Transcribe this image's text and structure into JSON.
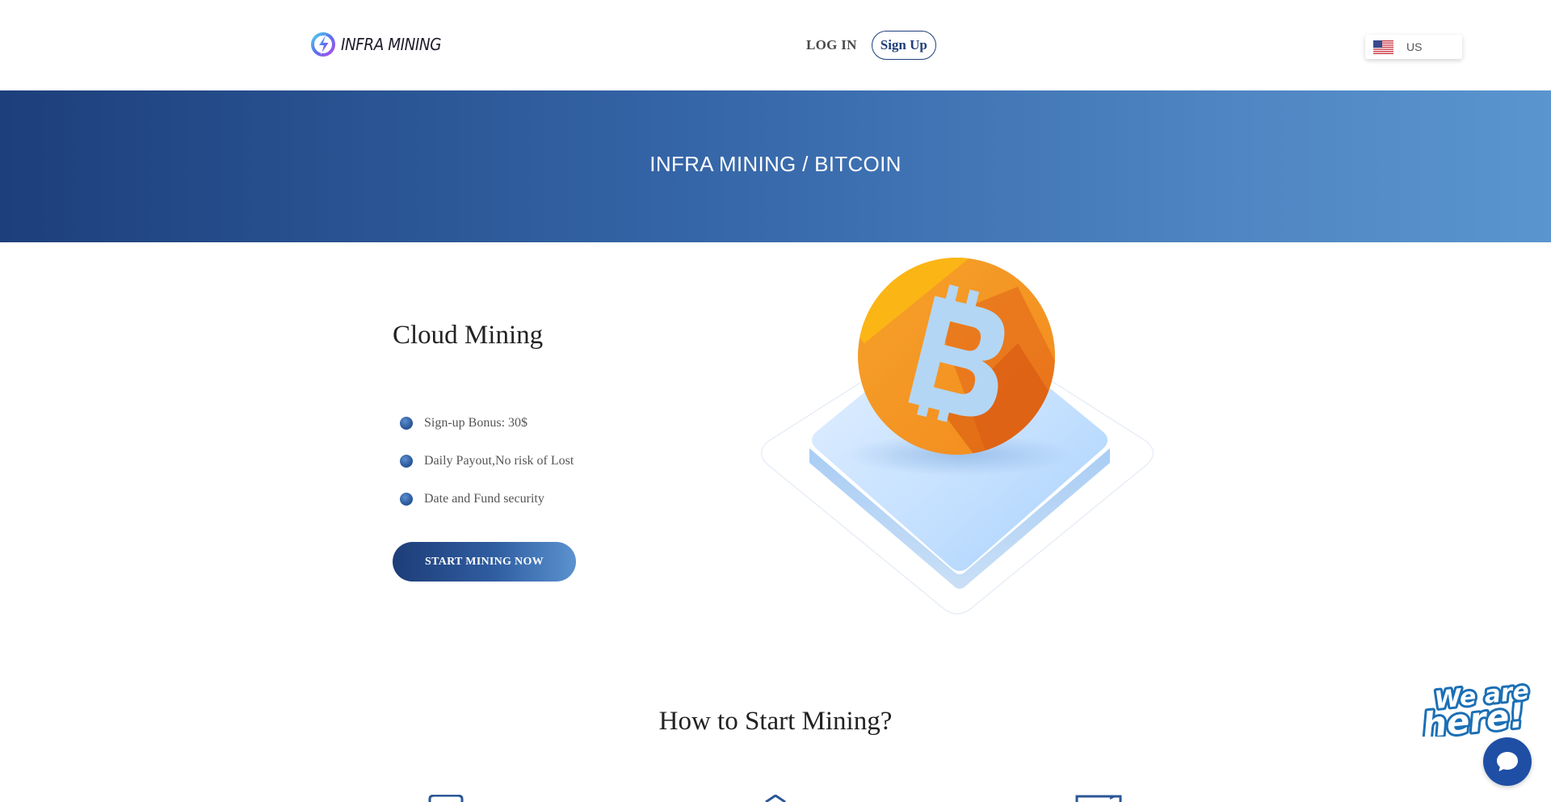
{
  "header": {
    "logo_text": "INFRA  MINING",
    "login_label": "LOG IN",
    "signup_label": "Sign Up",
    "language": {
      "selected": "US",
      "flag_icon": "us-flag-icon"
    }
  },
  "banner": {
    "title": "INFRA MINING / BITCOIN"
  },
  "hero": {
    "heading": "Cloud Mining",
    "features": [
      "Sign-up Bonus: 30$",
      "Daily Payout,No risk of Lost",
      "Date and Fund security"
    ],
    "cta_label": "START MINING NOW",
    "illustration_icon": "bitcoin-coin-icon"
  },
  "how_to": {
    "heading": "How to Start Mining?",
    "step_icons": [
      "wallet-icon",
      "home-icon",
      "monitor-icon"
    ]
  },
  "chat_widget": {
    "badge_icon": "we-are-here-badge-icon",
    "button_icon": "chat-bubble-icon"
  },
  "colors": {
    "brand_dark": "#1d3f7b",
    "brand_light": "#5a95cf",
    "bitcoin_orange": "#f7931a",
    "chat_blue": "#1e4fa5"
  }
}
